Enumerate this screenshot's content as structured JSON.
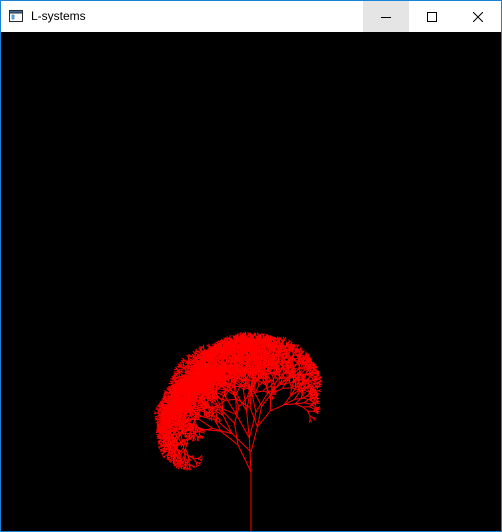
{
  "window": {
    "title": "L-systems",
    "app_icon": "window-app-icon",
    "controls": {
      "minimize_icon": "minimize-icon",
      "maximize_icon": "maximize-icon",
      "close_icon": "close-icon"
    }
  },
  "canvas": {
    "background_color": "#000000",
    "stroke_color": "#ff0000",
    "figure": "fractal-plant"
  }
}
